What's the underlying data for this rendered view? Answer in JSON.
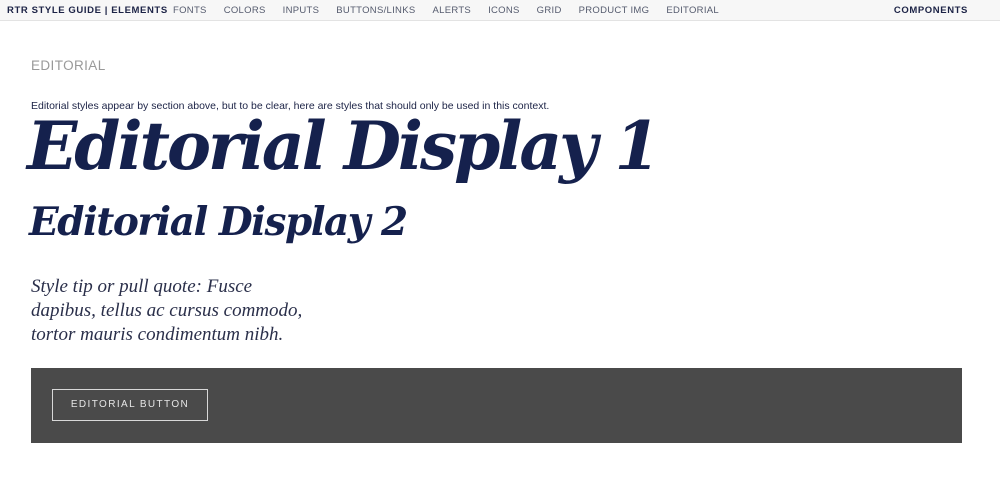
{
  "nav": {
    "brand": "RTR STYLE GUIDE | ELEMENTS",
    "links": [
      "FONTS",
      "COLORS",
      "INPUTS",
      "BUTTONS/LINKS",
      "ALERTS",
      "ICONS",
      "GRID",
      "PRODUCT IMG",
      "EDITORIAL"
    ],
    "right": "COMPONENTS"
  },
  "section": {
    "title": "EDITORIAL",
    "intro": "Editorial styles appear by section above, but to be clear, here are styles that should only be used in this context."
  },
  "samples": {
    "display1": "Editorial Display 1",
    "display2": "Editorial Display 2",
    "quote": "Style tip or pull quote: Fusce dapibus, tellus ac cursus commodo, tortor mauris condimentum nibh."
  },
  "band": {
    "button_label": "EDITORIAL BUTTON"
  },
  "colors": {
    "navy": "#15214d",
    "band": "#4a4a4a",
    "muted": "#999999"
  }
}
